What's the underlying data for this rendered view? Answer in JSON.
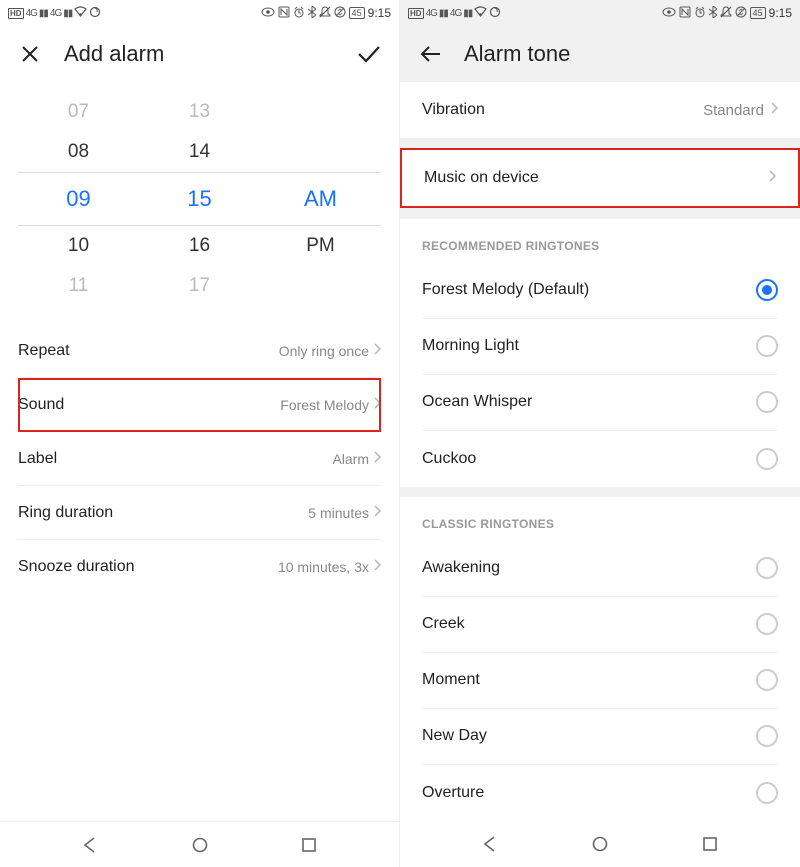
{
  "status": {
    "hd": "HD",
    "net": "4G",
    "battery": "45",
    "time": "9:15"
  },
  "left": {
    "title": "Add alarm",
    "picker": {
      "hours": [
        "07",
        "08",
        "09",
        "10",
        "11"
      ],
      "minutes": [
        "13",
        "14",
        "15",
        "16",
        "17"
      ],
      "ampm_sel": "AM",
      "ampm_other": "PM"
    },
    "rows": {
      "repeat": {
        "label": "Repeat",
        "value": "Only ring once"
      },
      "sound": {
        "label": "Sound",
        "value": "Forest Melody"
      },
      "labelrow": {
        "label": "Label",
        "value": "Alarm"
      },
      "ring": {
        "label": "Ring duration",
        "value": "5 minutes"
      },
      "snooze": {
        "label": "Snooze duration",
        "value": "10 minutes, 3x"
      }
    }
  },
  "right": {
    "title": "Alarm tone",
    "vibration": {
      "label": "Vibration",
      "value": "Standard"
    },
    "music": {
      "label": "Music on device"
    },
    "sections": {
      "recommended": {
        "header": "RECOMMENDED RINGTONES",
        "items": [
          {
            "label": "Forest Melody (Default)",
            "selected": true
          },
          {
            "label": "Morning Light",
            "selected": false
          },
          {
            "label": "Ocean Whisper",
            "selected": false
          },
          {
            "label": "Cuckoo",
            "selected": false
          }
        ]
      },
      "classic": {
        "header": "CLASSIC RINGTONES",
        "items": [
          {
            "label": "Awakening",
            "selected": false
          },
          {
            "label": "Creek",
            "selected": false
          },
          {
            "label": "Moment",
            "selected": false
          },
          {
            "label": "New Day",
            "selected": false
          },
          {
            "label": "Overture",
            "selected": false
          }
        ]
      }
    }
  }
}
